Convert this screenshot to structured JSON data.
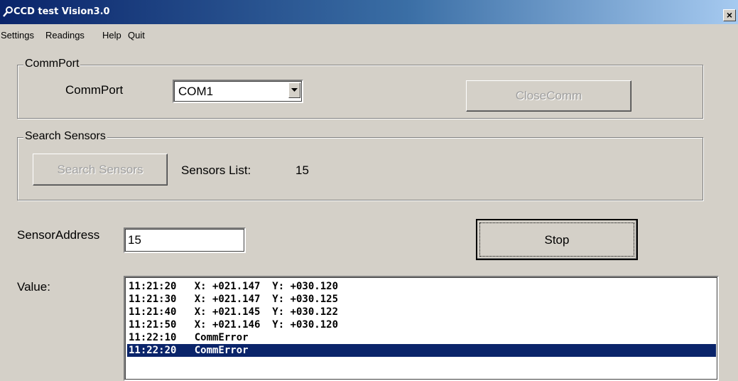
{
  "window": {
    "title": "CCD test Vision3.0",
    "close_glyph": "×"
  },
  "menu": [
    "Settings",
    "Readings",
    "Help",
    "Quit"
  ],
  "commport_group": {
    "legend": "CommPort",
    "label": "CommPort",
    "selected_port": "COM1",
    "close_button": "CloseComm"
  },
  "search_group": {
    "legend": "Search Sensors",
    "search_button": "Search Sensors",
    "sensors_list_label": "Sensors List:",
    "sensors_list_value": "15"
  },
  "sensor_address": {
    "label": "SensorAddress",
    "value": "15"
  },
  "stop_button": "Stop",
  "value_label": "Value:",
  "readings": [
    "11:21:20   X: +021.147  Y: +030.120",
    "11:21:30   X: +021.147  Y: +030.125",
    "11:21:40   X: +021.145  Y: +030.122",
    "11:21:50   X: +021.146  Y: +030.120",
    "11:22:10   CommError",
    "11:22:20   CommError"
  ],
  "selected_reading_index": 5,
  "colors": {
    "selection": "#0a246a",
    "title_start": "#0a246a",
    "title_end": "#a6caf0",
    "face": "#d4d0c8"
  }
}
